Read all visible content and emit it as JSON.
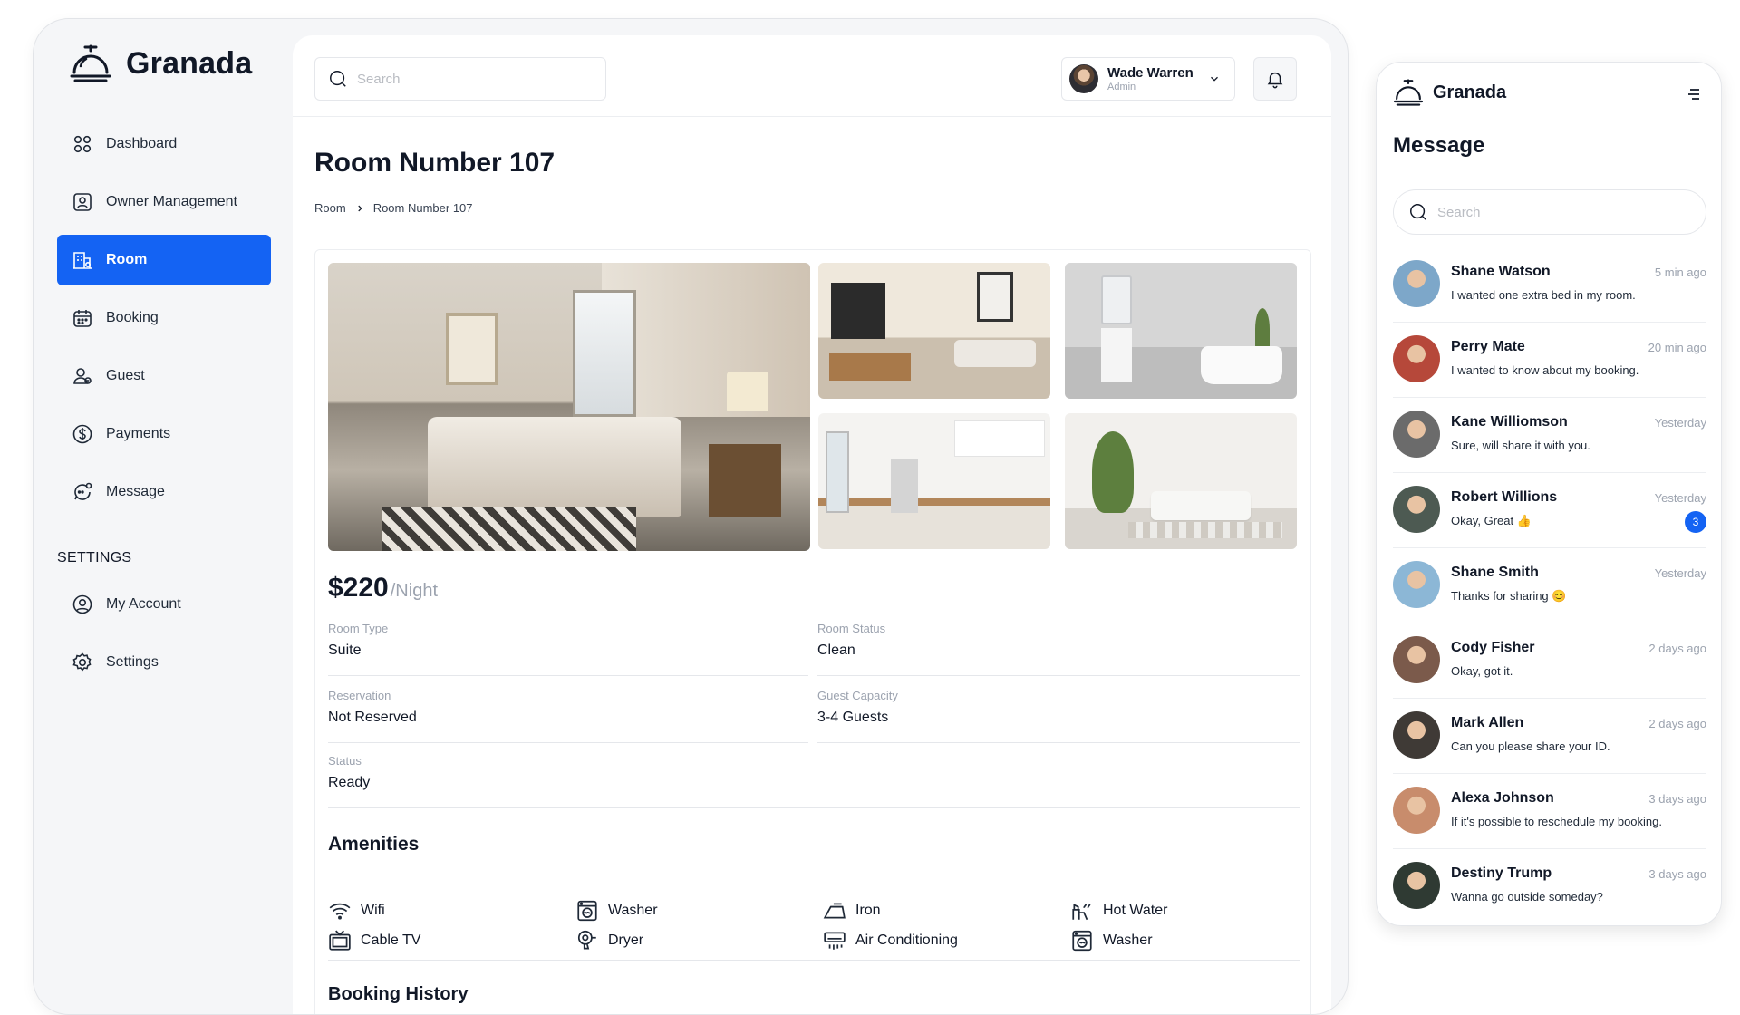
{
  "app": {
    "name": "Granada"
  },
  "sidebar": {
    "items": [
      {
        "label": "Dashboard",
        "icon": "grid-icon"
      },
      {
        "label": "Owner Management",
        "icon": "id-card-icon"
      },
      {
        "label": "Room",
        "icon": "building-icon",
        "active": true
      },
      {
        "label": "Booking",
        "icon": "calendar-icon"
      },
      {
        "label": "Guest",
        "icon": "users-icon"
      },
      {
        "label": "Payments",
        "icon": "dollar-circle-icon"
      },
      {
        "label": "Message",
        "icon": "chat-icon"
      }
    ],
    "settings_heading": "SETTINGS",
    "settings_items": [
      {
        "label": "My Account",
        "icon": "user-circle-icon"
      },
      {
        "label": "Settings",
        "icon": "gear-icon"
      }
    ]
  },
  "header": {
    "search_placeholder": "Search",
    "user": {
      "name": "Wade Warren",
      "role": "Admin"
    }
  },
  "page": {
    "title": "Room Number 107",
    "breadcrumb": [
      "Room",
      "Room Number 107"
    ]
  },
  "room": {
    "price": "$220",
    "price_unit": "/Night",
    "details": [
      {
        "label": "Room Type",
        "value": "Suite"
      },
      {
        "label": "Room Status",
        "value": "Clean"
      },
      {
        "label": "Reservation",
        "value": "Not Reserved"
      },
      {
        "label": "Guest Capacity",
        "value": "3-4 Guests"
      },
      {
        "label": "Status",
        "value": "Ready"
      }
    ],
    "amenities_title": "Amenities",
    "amenities": [
      {
        "label": "Wifi",
        "icon": "wifi-icon"
      },
      {
        "label": "Washer",
        "icon": "washer-icon"
      },
      {
        "label": "Iron",
        "icon": "iron-icon"
      },
      {
        "label": "Hot Water",
        "icon": "hot-water-icon"
      },
      {
        "label": "Cable TV",
        "icon": "tv-icon"
      },
      {
        "label": "Dryer",
        "icon": "dryer-icon"
      },
      {
        "label": "Air Conditioning",
        "icon": "air-conditioner-icon"
      },
      {
        "label": "Washer",
        "icon": "washer-icon"
      }
    ],
    "booking_history_title": "Booking History"
  },
  "messages": {
    "brand": "Granada",
    "title": "Message",
    "search_placeholder": "Search",
    "conversations": [
      {
        "name": "Shane Watson",
        "time": "5 min ago",
        "text": "I wanted one extra bed in my room.",
        "avatar_color": "#7da7c9"
      },
      {
        "name": "Perry Mate",
        "time": "20 min ago",
        "text": "I wanted to know about my booking.",
        "avatar_color": "#b6483a"
      },
      {
        "name": "Kane Williomson",
        "time": "Yesterday",
        "text": "Sure, will share it with you.",
        "avatar_color": "#6b6b6b"
      },
      {
        "name": "Robert Willions",
        "time": "Yesterday",
        "text": "Okay, Great 👍",
        "unread": "3",
        "avatar_color": "#4d5a52"
      },
      {
        "name": "Shane Smith",
        "time": "Yesterday",
        "text": "Thanks for sharing 😊",
        "avatar_color": "#8cb7d6"
      },
      {
        "name": "Cody Fisher",
        "time": "2 days ago",
        "text": "Okay, got it.",
        "avatar_color": "#7b5a4b"
      },
      {
        "name": "Mark Allen",
        "time": "2 days ago",
        "text": "Can you please share your ID.",
        "avatar_color": "#3f3a36"
      },
      {
        "name": "Alexa Johnson",
        "time": "3 days ago",
        "text": "If it's possible to reschedule my booking.",
        "avatar_color": "#c88c6c"
      },
      {
        "name": "Destiny Trump",
        "time": "3 days ago",
        "text": "Wanna go outside someday?",
        "avatar_color": "#2f3a33"
      }
    ]
  },
  "colors": {
    "accent": "#1463f3",
    "badge": "#1463f3"
  }
}
